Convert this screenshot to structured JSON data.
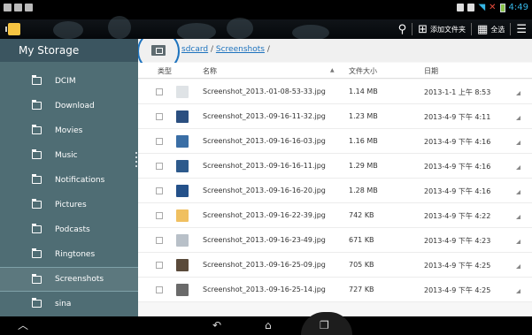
{
  "status_bar": {
    "time": "4:49"
  },
  "action_bar": {
    "add_folder_label": "添加文件夹",
    "select_all_label": "全选"
  },
  "sidebar": {
    "title": "My Storage",
    "items": [
      {
        "label": "DCIM"
      },
      {
        "label": "Download"
      },
      {
        "label": "Movies"
      },
      {
        "label": "Music"
      },
      {
        "label": "Notifications"
      },
      {
        "label": "Pictures"
      },
      {
        "label": "Podcasts"
      },
      {
        "label": "Ringtones"
      },
      {
        "label": "Screenshots",
        "active": true
      },
      {
        "label": "sina"
      }
    ]
  },
  "path": {
    "root": "sdcard",
    "sep1": " / ",
    "folder": "Screenshots",
    "sep2": " /"
  },
  "columns": {
    "type": "类型",
    "name": "名称",
    "size": "文件大小",
    "date": "日期"
  },
  "files": [
    {
      "name": "Screenshot_2013.-01-08-53-33.jpg",
      "size": "1.14 MB",
      "date": "2013-1-1 上午 8:53",
      "thumb": "#dfe3e6"
    },
    {
      "name": "Screenshot_2013.-09-16-11-32.jpg",
      "size": "1.23 MB",
      "date": "2013-4-9 下午 4:11",
      "thumb": "#2b4f80"
    },
    {
      "name": "Screenshot_2013.-09-16-16-03.jpg",
      "size": "1.16 MB",
      "date": "2013-4-9 下午 4:16",
      "thumb": "#3a6ea5"
    },
    {
      "name": "Screenshot_2013.-09-16-16-11.jpg",
      "size": "1.29 MB",
      "date": "2013-4-9 下午 4:16",
      "thumb": "#2d5a8c"
    },
    {
      "name": "Screenshot_2013.-09-16-16-20.jpg",
      "size": "1.28 MB",
      "date": "2013-4-9 下午 4:16",
      "thumb": "#24518a"
    },
    {
      "name": "Screenshot_2013.-09-16-22-39.jpg",
      "size": "742 KB",
      "date": "2013-4-9 下午 4:22",
      "thumb": "#f0c060"
    },
    {
      "name": "Screenshot_2013.-09-16-23-49.jpg",
      "size": "671 KB",
      "date": "2013-4-9 下午 4:23",
      "thumb": "#b8c0c8"
    },
    {
      "name": "Screenshot_2013.-09-16-25-09.jpg",
      "size": "705 KB",
      "date": "2013-4-9 下午 4:25",
      "thumb": "#5a4a3a"
    },
    {
      "name": "Screenshot_2013.-09-16-25-14.jpg",
      "size": "727 KB",
      "date": "2013-4-9 下午 4:25",
      "thumb": "#6a6a6a"
    }
  ]
}
